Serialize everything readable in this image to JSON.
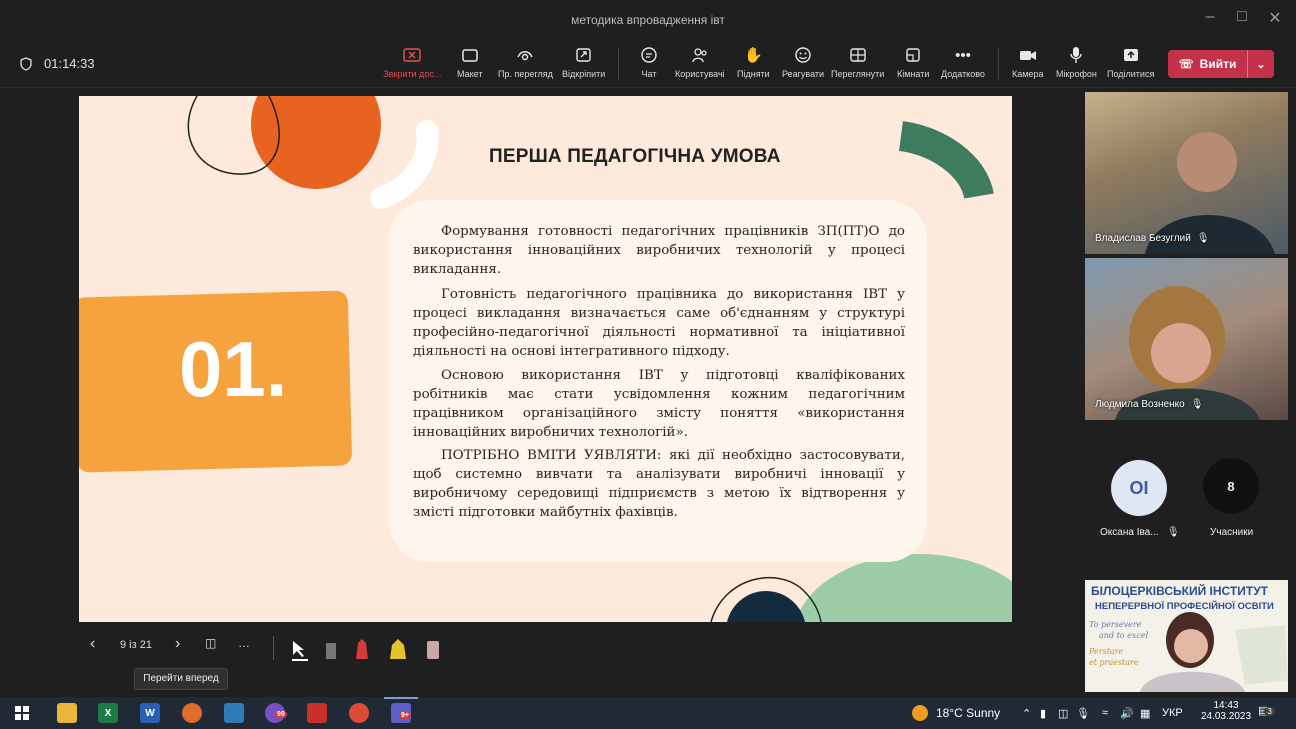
{
  "window": {
    "title": "методика впровадження івт"
  },
  "meeting": {
    "timer": "01:14:33",
    "toolbar": [
      {
        "id": "stop-share",
        "label": "Закрити дос..."
      },
      {
        "id": "layout",
        "label": "Макет"
      },
      {
        "id": "presenter-view",
        "label": "Пр. перегляд"
      },
      {
        "id": "popout",
        "label": "Відкріпити"
      },
      {
        "id": "chat",
        "label": "Чат"
      },
      {
        "id": "people",
        "label": "Користувачі"
      },
      {
        "id": "raise",
        "label": "Підняти"
      },
      {
        "id": "react",
        "label": "Реагувати"
      },
      {
        "id": "view",
        "label": "Переглянути"
      },
      {
        "id": "rooms",
        "label": "Кімнати"
      },
      {
        "id": "more",
        "label": "Додатково"
      },
      {
        "id": "camera",
        "label": "Камера"
      },
      {
        "id": "mic",
        "label": "Мікрофон"
      },
      {
        "id": "share",
        "label": "Поділитися"
      }
    ],
    "leave_label": "Вийти"
  },
  "slide": {
    "title": "ПЕРША ПЕДАГОГІЧНА УМОВА",
    "number": "01.",
    "paragraphs": [
      "Формування готовності педагогічних працівників ЗП(ПТ)О до використання інноваційних виробничих технологій у процесі викладання.",
      "Готовність педагогічного працівника до використання ІВТ у процесі викладання визначається саме об'єднанням у структурі професійно-педагогічної діяльності нормативної та ініціативної діяльності на основі інтегративного підходу.",
      "Основою використання ІВТ у підготовці кваліфікованих робітників має стати усвідомлення кожним педагогічним працівником організаційного змісту поняття «використання інноваційних виробничих технологій».",
      "ПОТРІБНО ВМІТИ УЯВЛЯТИ: які дії необхідно застосовувати, щоб системно вивчати та аналізувати виробничі інновації у виробничому середовищі підприємств з метою їх відтворення у змісті підготовки майбутніх фахівців."
    ]
  },
  "participants": {
    "p1": "Владислав Безуглий",
    "p2": "Людмила Возненко",
    "p3_initials": "ОІ",
    "p3": "Оксана Іва...",
    "count": "8",
    "count_label": "Учасники",
    "banner_title": "БІЛОЦЕРКІВСЬКИЙ ІНСТИТУТ",
    "banner_sub": "НЕПЕРЕРВНОЇ ПРОФЕСІЙНОЇ ОСВІТИ",
    "banner_motto1": "To persevere",
    "banner_motto2": "and to excel",
    "banner_motto3": "Perstare",
    "banner_motto4": "et praestare"
  },
  "presenter": {
    "page": "9 із 21",
    "tooltip": "Перейти вперед"
  },
  "taskbar": {
    "weather": "18°C  Sunny",
    "lang": "УКР",
    "time": "14:43",
    "date": "24.03.2023",
    "notif": "3",
    "badge_viber": "99",
    "badge_teams": "9+"
  },
  "colors": {
    "leave": "#c4314b",
    "slide_bg": "#fdeadc",
    "orange": "#f6a23f",
    "deep_orange": "#e8631f",
    "green": "#3f7b5e",
    "mint": "#9ccba8"
  }
}
